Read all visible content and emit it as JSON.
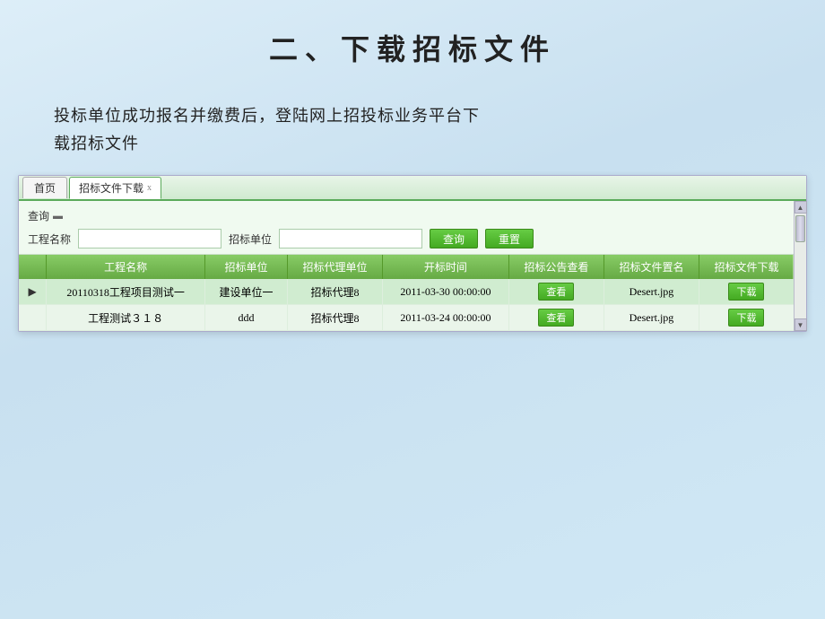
{
  "page": {
    "title": "二、下载招标文件",
    "description_line1": "投标单位成功报名并缴费后，登陆网上招投标业务平台下",
    "description_line2": "载招标文件"
  },
  "tabs": {
    "home_label": "首页",
    "active_label": "招标文件下载",
    "active_close": "x"
  },
  "search": {
    "section_label": "查询",
    "field1_label": "工程名称",
    "field2_label": "招标单位",
    "field1_placeholder": "",
    "field2_placeholder": "",
    "btn_search": "查询",
    "btn_reset": "重置"
  },
  "table": {
    "headers": [
      "工程名称",
      "招标单位",
      "招标代理单位",
      "开标时间",
      "招标公告查看",
      "招标文件置名",
      "招标文件下载"
    ],
    "rows": [
      {
        "marker": "▶",
        "name": "20110318工程项目测试一",
        "tender_unit": "建设单位一",
        "agent": "招标代理8",
        "open_time": "2011-03-30 00:00:00",
        "notice_btn": "查看",
        "file_name": "Desert.jpg",
        "download_btn": "下载"
      },
      {
        "marker": "",
        "name": "工程测试３１８",
        "tender_unit": "ddd",
        "agent": "招标代理8",
        "open_time": "2011-03-24 00:00:00",
        "notice_btn": "查看",
        "file_name": "Desert.jpg",
        "download_btn": "下载"
      }
    ]
  },
  "scrollbar": {
    "up_arrow": "▲",
    "down_arrow": "▼"
  }
}
